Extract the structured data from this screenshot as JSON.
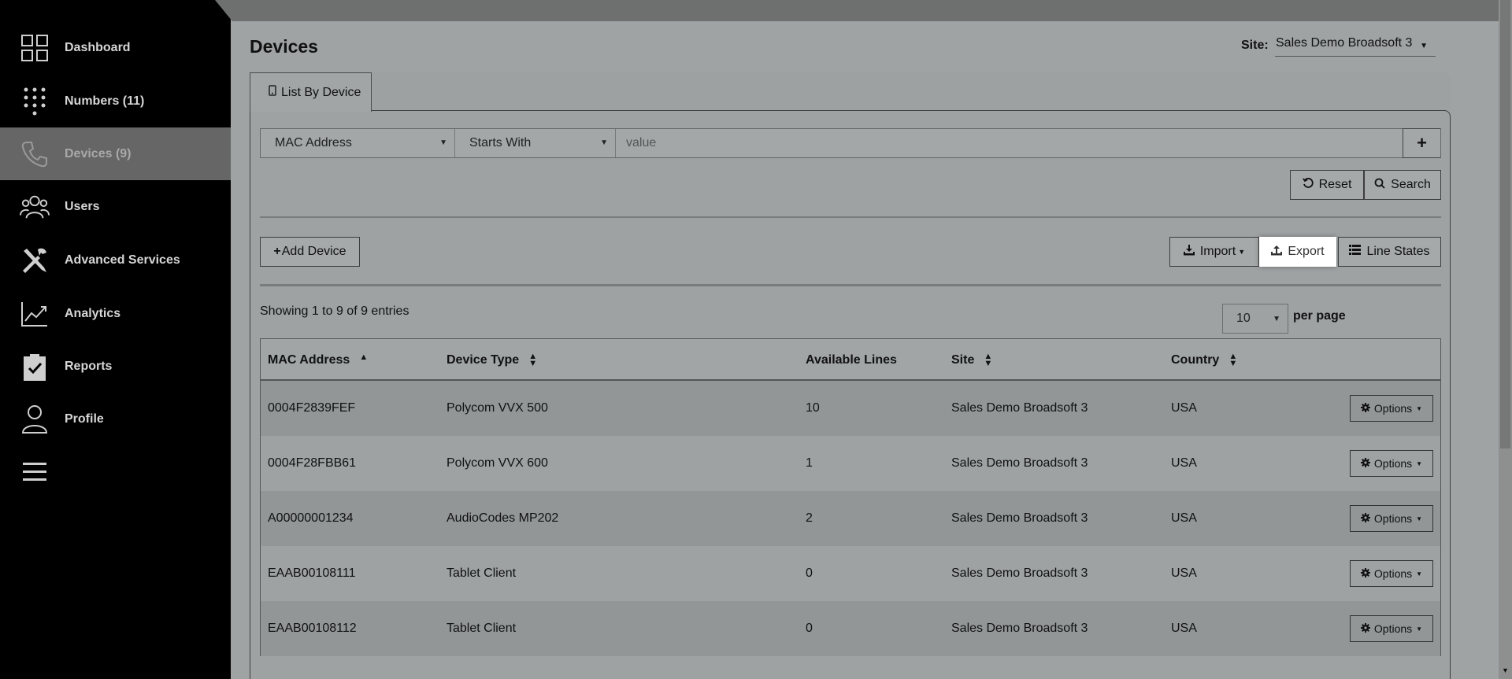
{
  "sidebar": {
    "items": [
      {
        "label": "Dashboard",
        "icon": "grid-icon"
      },
      {
        "label": "Numbers (11)",
        "icon": "keypad-icon"
      },
      {
        "label": "Devices (9)",
        "icon": "phone-icon"
      },
      {
        "label": "Users",
        "icon": "users-icon"
      },
      {
        "label": "Advanced Services",
        "icon": "tools-icon"
      },
      {
        "label": "Analytics",
        "icon": "chart-icon"
      },
      {
        "label": "Reports",
        "icon": "clipboard-icon"
      },
      {
        "label": "Profile",
        "icon": "person-icon"
      }
    ]
  },
  "header": {
    "title": "Devices",
    "site_label": "Site:",
    "site_value": "Sales Demo Broadsoft 3"
  },
  "tab": {
    "label": "List By Device"
  },
  "filter": {
    "field": "MAC Address",
    "operator": "Starts With",
    "value_placeholder": "value",
    "add": "+"
  },
  "actions": {
    "reset": "Reset",
    "search": "Search",
    "add_device": "Add Device",
    "import": "Import",
    "export": "Export",
    "line_states": "Line States"
  },
  "listing": {
    "showing": "Showing 1 to 9 of 9 entries",
    "per_page_value": "10",
    "per_page_label": "per page"
  },
  "table": {
    "columns": [
      "MAC Address",
      "Device Type",
      "Available Lines",
      "Site",
      "Country"
    ],
    "options_label": "Options",
    "rows": [
      {
        "mac": "0004F2839FEF",
        "type": "Polycom VVX 500",
        "lines": "10",
        "site": "Sales Demo Broadsoft 3",
        "country": "USA"
      },
      {
        "mac": "0004F28FBB61",
        "type": "Polycom VVX 600",
        "lines": "1",
        "site": "Sales Demo Broadsoft 3",
        "country": "USA"
      },
      {
        "mac": "A00000001234",
        "type": "AudioCodes MP202",
        "lines": "2",
        "site": "Sales Demo Broadsoft 3",
        "country": "USA"
      },
      {
        "mac": "EAAB00108111",
        "type": "Tablet Client",
        "lines": "0",
        "site": "Sales Demo Broadsoft 3",
        "country": "USA"
      },
      {
        "mac": "EAAB00108112",
        "type": "Tablet Client",
        "lines": "0",
        "site": "Sales Demo Broadsoft 3",
        "country": "USA"
      }
    ]
  }
}
